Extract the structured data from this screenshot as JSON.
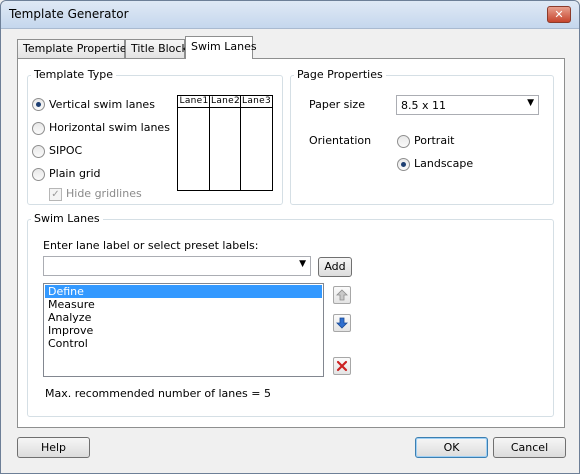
{
  "window": {
    "title": "Template Generator",
    "close_glyph": "✕"
  },
  "tabs": [
    {
      "label": "Template Properties",
      "active": false
    },
    {
      "label": "Title Block",
      "active": false
    },
    {
      "label": "Swim Lanes",
      "active": true
    }
  ],
  "template_type": {
    "legend": "Template Type",
    "options": [
      {
        "label": "Vertical swim lanes",
        "selected": true
      },
      {
        "label": "Horizontal swim lanes",
        "selected": false
      },
      {
        "label": "SIPOC",
        "selected": false
      },
      {
        "label": "Plain grid",
        "selected": false
      }
    ],
    "hide_gridlines": {
      "label": "Hide gridlines",
      "checked": true,
      "enabled": false
    },
    "preview_lanes": [
      "Lane1",
      "Lane2",
      "Lane3"
    ]
  },
  "page_properties": {
    "legend": "Page Properties",
    "paper_size_label": "Paper size",
    "paper_size_value": "8.5 x 11",
    "orientation_label": "Orientation",
    "orientation_options": [
      {
        "label": "Portrait",
        "selected": false
      },
      {
        "label": "Landscape",
        "selected": true
      }
    ]
  },
  "swim_lanes": {
    "legend": "Swim Lanes",
    "input_label": "Enter lane label or select preset labels:",
    "input_value": "",
    "add_label": "Add",
    "lanes": [
      "Define",
      "Measure",
      "Analyze",
      "Improve",
      "Control"
    ],
    "selected_index": 0,
    "max_note": "Max. recommended number of lanes = 5"
  },
  "footer": {
    "help_label": "Help",
    "ok_label": "OK",
    "cancel_label": "Cancel"
  },
  "icons": {
    "move_up": "arrow-up-icon",
    "move_down": "arrow-down-icon",
    "delete": "delete-icon"
  },
  "colors": {
    "selection": "#3399ff",
    "titlebar": "#c5d7ed",
    "arrow_down": "#2f6fcf",
    "delete": "#cc2222"
  }
}
